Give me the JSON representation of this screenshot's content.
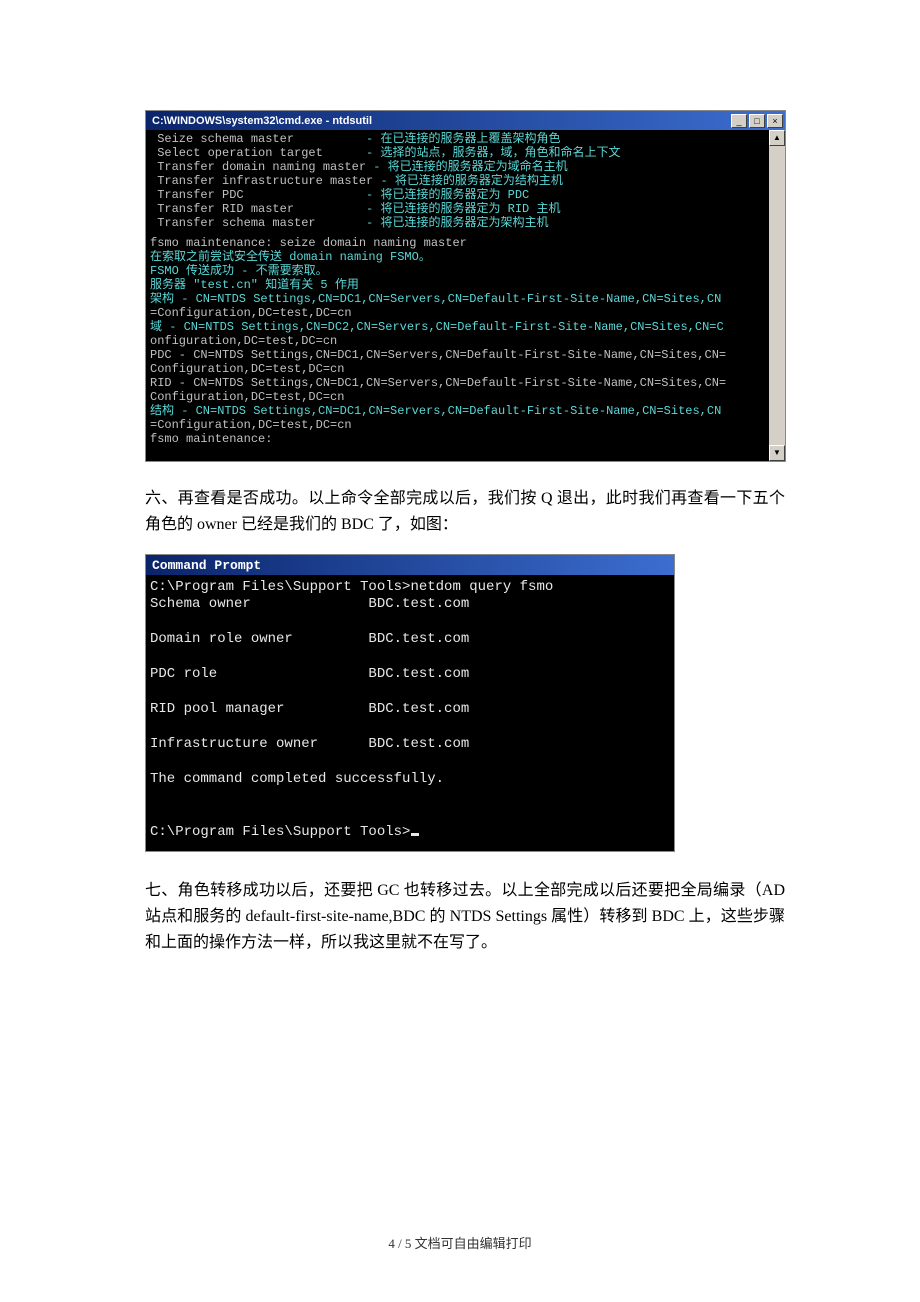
{
  "console1": {
    "title": "C:\\WINDOWS\\system32\\cmd.exe - ntdsutil",
    "winbtn_min": "_",
    "winbtn_max": "□",
    "winbtn_close": "×",
    "scroll_up": "▲",
    "scroll_down": "▼",
    "lines": [
      {
        "l": " Seize schema master          ",
        "r": "- 在已连接的服务器上覆盖架构角色"
      },
      {
        "l": " Select operation target      ",
        "r": "- 选择的站点，服务器，域，角色和命名上下文"
      },
      {
        "l": " Transfer domain naming master ",
        "r": "- 将已连接的服务器定为域命名主机"
      },
      {
        "l": " Transfer infrastructure master ",
        "r": "- 将已连接的服务器定为结构主机"
      },
      {
        "l": " Transfer PDC                 ",
        "r": "- 将已连接的服务器定为 PDC"
      },
      {
        "l": " Transfer RID master          ",
        "r": "- 将已连接的服务器定为 RID 主机"
      },
      {
        "l": " Transfer schema master       ",
        "r": "- 将已连接的服务器定为架构主机"
      }
    ],
    "block2": [
      {
        "c": "plain",
        "t": "fsmo maintenance: seize domain naming master"
      },
      {
        "c": "cyan",
        "t": "在索取之前尝试安全传送 domain naming FSMO。"
      },
      {
        "c": "cyan",
        "t": "FSMO 传送成功 - 不需要索取。"
      },
      {
        "c": "cyan",
        "t": "服务器 \"test.cn\" 知道有关 5 作用"
      },
      {
        "c": "cyan",
        "t": "架构 - CN=NTDS Settings,CN=DC1,CN=Servers,CN=Default-First-Site-Name,CN=Sites,CN"
      },
      {
        "c": "plain",
        "t": "=Configuration,DC=test,DC=cn"
      },
      {
        "c": "cyan",
        "t": "域 - CN=NTDS Settings,CN=DC2,CN=Servers,CN=Default-First-Site-Name,CN=Sites,CN=C"
      },
      {
        "c": "plain",
        "t": "onfiguration,DC=test,DC=cn"
      },
      {
        "c": "plain",
        "t": "PDC - CN=NTDS Settings,CN=DC1,CN=Servers,CN=Default-First-Site-Name,CN=Sites,CN="
      },
      {
        "c": "plain",
        "t": "Configuration,DC=test,DC=cn"
      },
      {
        "c": "plain",
        "t": "RID - CN=NTDS Settings,CN=DC1,CN=Servers,CN=Default-First-Site-Name,CN=Sites,CN="
      },
      {
        "c": "plain",
        "t": "Configuration,DC=test,DC=cn"
      },
      {
        "c": "cyan",
        "t": "结构 - CN=NTDS Settings,CN=DC1,CN=Servers,CN=Default-First-Site-Name,CN=Sites,CN"
      },
      {
        "c": "plain",
        "t": "=Configuration,DC=test,DC=cn"
      },
      {
        "c": "plain",
        "t": "fsmo maintenance:"
      }
    ]
  },
  "para1": "六、再查看是否成功。以上命令全部完成以后，我们按 Q 退出，此时我们再查看一下五个角色的 owner 已经是我们的 BDC 了，如图：",
  "console2": {
    "title": "Command Prompt",
    "lines": [
      "C:\\Program Files\\Support Tools>netdom query fsmo",
      "Schema owner              BDC.test.com",
      "",
      "Domain role owner         BDC.test.com",
      "",
      "PDC role                  BDC.test.com",
      "",
      "RID pool manager          BDC.test.com",
      "",
      "Infrastructure owner      BDC.test.com",
      "",
      "The command completed successfully.",
      "",
      ""
    ],
    "prompt": "C:\\Program Files\\Support Tools>"
  },
  "para2": "七、角色转移成功以后，还要把 GC 也转移过去。以上全部完成以后还要把全局编录（AD 站点和服务的 default-first-site-name,BDC 的 NTDS Settings 属性）转移到 BDC 上，这些步骤和上面的操作方法一样，所以我这里就不在写了。",
  "footer": "4 / 5 文档可自由编辑打印"
}
